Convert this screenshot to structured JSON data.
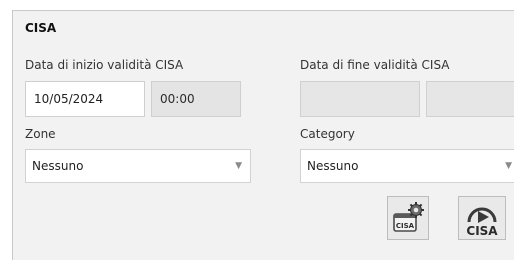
{
  "group": {
    "title": "CISA"
  },
  "start": {
    "label": "Data di inizio validità CISA",
    "date": "10/05/2024",
    "time": "00:00"
  },
  "end": {
    "label": "Data di fine validità CISA",
    "date": "",
    "time": ""
  },
  "zone": {
    "label": "Zone",
    "value": "Nessuno"
  },
  "category": {
    "label": "Category",
    "value": "Nessuno"
  },
  "buttons": {
    "settings_icon_text": "CISA",
    "play_icon_text": "CISA"
  },
  "icons": {
    "dropdown": "chevron-down-icon",
    "settings": "cisa-settings-icon",
    "play": "cisa-play-icon"
  }
}
